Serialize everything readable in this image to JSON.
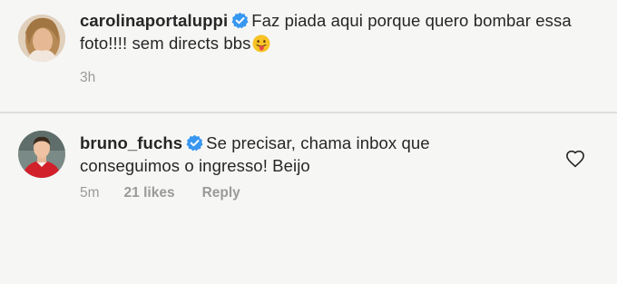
{
  "caption": {
    "username": "carolinaportaluppi",
    "text": "Faz piada aqui porque quero bombar essa foto!!!! sem directs bbs",
    "timestamp": "3h"
  },
  "comment": {
    "username": "bruno_fuchs",
    "text": "Se precisar, chama inbox que conseguimos o ingresso! Beijo",
    "timestamp": "5m",
    "likes": "21 likes",
    "reply_label": "Reply"
  },
  "icons": {
    "verified": "verified-badge-icon",
    "emoji": "tongue-out-emoji-icon",
    "like": "heart-outline-icon"
  },
  "colors": {
    "verified_blue": "#3897f0",
    "text": "#262626",
    "meta_gray": "#9a9a9a",
    "background": "#f6f6f5"
  }
}
